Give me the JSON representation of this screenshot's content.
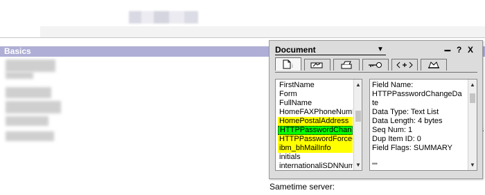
{
  "background": {
    "section_label": "Basics",
    "right_edge_char": "s",
    "bottom_label": "Sametime server:"
  },
  "dialog": {
    "title": "Document",
    "dropdown_glyph": "▼",
    "menu_glyph": "▪▪▪▪",
    "help_glyph": "?",
    "close_glyph": "X",
    "tabs": [
      {
        "icon": "info-page-icon",
        "active": true
      },
      {
        "icon": "field-design-icon",
        "active": false
      },
      {
        "icon": "printer-icon",
        "active": false
      },
      {
        "icon": "key-icon",
        "active": false
      },
      {
        "icon": "html-tags-icon",
        "active": false
      },
      {
        "icon": "hat-icon",
        "active": false
      }
    ],
    "fields": [
      {
        "name": "FirstName",
        "style": ""
      },
      {
        "name": "Form",
        "style": ""
      },
      {
        "name": "FullName",
        "style": ""
      },
      {
        "name": "HomeFAXPhoneNumber",
        "style": ""
      },
      {
        "name": "HomePostalAddress",
        "style": "highlight"
      },
      {
        "name": "HTTPPasswordChangeDate",
        "style": "selected"
      },
      {
        "name": "HTTPPasswordForceChange",
        "style": "highlight"
      },
      {
        "name": "ibm_bhMailInfo",
        "style": "highlight"
      },
      {
        "name": "initials",
        "style": ""
      },
      {
        "name": "internationaliSDNNumber",
        "style": ""
      }
    ],
    "info": {
      "field_name_label": "Field Name:",
      "field_name_line1": "HTTPPasswordChangeDa",
      "field_name_line2": "te",
      "data_type": "Data Type: Text List",
      "data_length": "Data Length: 4 bytes",
      "seq_num": "Seq Num: 1",
      "dup_item": "Dup Item ID: 0",
      "field_flags": "Field Flags: SUMMARY",
      "value": "\"\""
    }
  },
  "colors": {
    "basics_bar": "#aeaed6",
    "dialog_bg": "#dcdcdc",
    "highlight_yellow": "#ffff00",
    "selected_green": "#00ff00"
  }
}
